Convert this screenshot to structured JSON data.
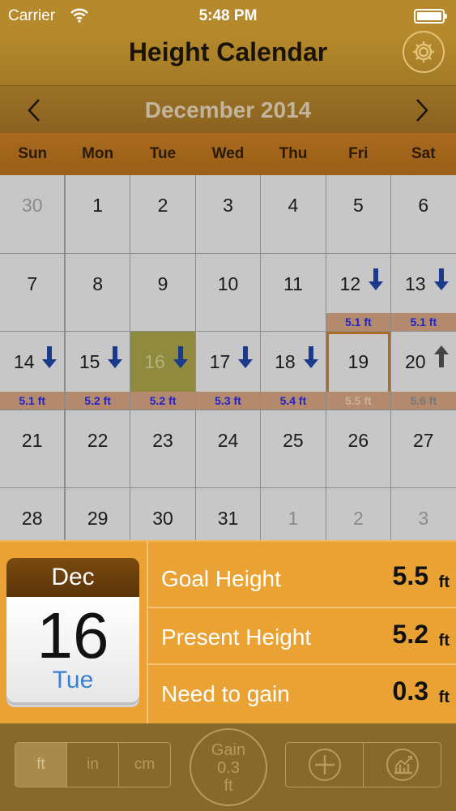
{
  "status_bar": {
    "carrier": "Carrier",
    "time": "5:48 PM"
  },
  "nav": {
    "title": "Height Calendar"
  },
  "month": {
    "label": "December 2014"
  },
  "weekdays": [
    "Sun",
    "Mon",
    "Tue",
    "Wed",
    "Thu",
    "Fri",
    "Sat"
  ],
  "days": [
    {
      "day": "30",
      "other": true
    },
    {
      "day": "1"
    },
    {
      "day": "2"
    },
    {
      "day": "3"
    },
    {
      "day": "4"
    },
    {
      "day": "5"
    },
    {
      "day": "6"
    },
    {
      "day": "7"
    },
    {
      "day": "8"
    },
    {
      "day": "9"
    },
    {
      "day": "10"
    },
    {
      "day": "11"
    },
    {
      "day": "12",
      "arrow": "down",
      "height": "5.1 ft"
    },
    {
      "day": "13",
      "arrow": "down",
      "height": "5.1 ft"
    },
    {
      "day": "14",
      "arrow": "down",
      "height": "5.1 ft"
    },
    {
      "day": "15",
      "arrow": "down",
      "height": "5.2 ft"
    },
    {
      "day": "16",
      "arrow": "down",
      "height": "5.2 ft",
      "selected": true
    },
    {
      "day": "17",
      "arrow": "down",
      "height": "5.3 ft"
    },
    {
      "day": "18",
      "arrow": "down",
      "height": "5.4 ft"
    },
    {
      "day": "19",
      "height": "5.5 ft",
      "today": true,
      "height_style": "dim"
    },
    {
      "day": "20",
      "arrow": "up",
      "height": "5.6 ft",
      "height_style": "gray"
    },
    {
      "day": "21"
    },
    {
      "day": "22"
    },
    {
      "day": "23"
    },
    {
      "day": "24"
    },
    {
      "day": "25"
    },
    {
      "day": "26"
    },
    {
      "day": "27"
    },
    {
      "day": "28"
    },
    {
      "day": "29"
    },
    {
      "day": "30"
    },
    {
      "day": "31"
    },
    {
      "day": "1",
      "other": true
    },
    {
      "day": "2",
      "other": true
    },
    {
      "day": "3",
      "other": true
    }
  ],
  "selected_date": {
    "month": "Dec",
    "day": "16",
    "weekday": "Tue"
  },
  "stats": [
    {
      "label": "Goal Height",
      "value": "5.5",
      "unit": "ft"
    },
    {
      "label": "Present Height",
      "value": "5.2",
      "unit": "ft"
    },
    {
      "label": "Need to gain",
      "value": "0.3",
      "unit": "ft"
    }
  ],
  "units": {
    "options": [
      "ft",
      "in",
      "cm"
    ],
    "selected": "ft"
  },
  "gain": {
    "label": "Gain",
    "value": "0.3",
    "unit": "ft"
  },
  "colors": {
    "accent": "#e9a233",
    "arrow": "#1a3a8a",
    "height_text": "#2222cc"
  }
}
